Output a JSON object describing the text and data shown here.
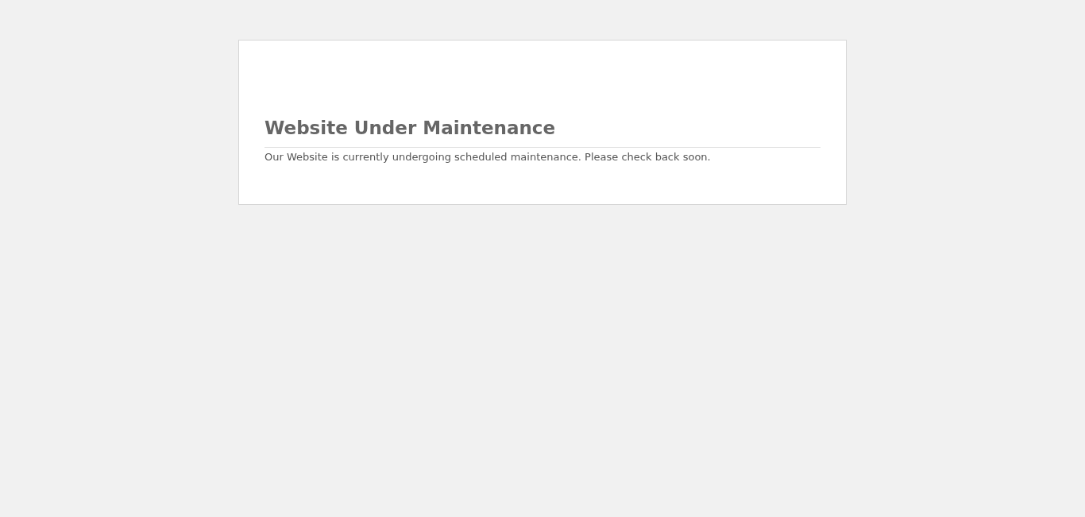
{
  "card": {
    "title": "Website Under Maintenance",
    "message": "Our Website is currently undergoing scheduled maintenance. Please check back soon."
  }
}
